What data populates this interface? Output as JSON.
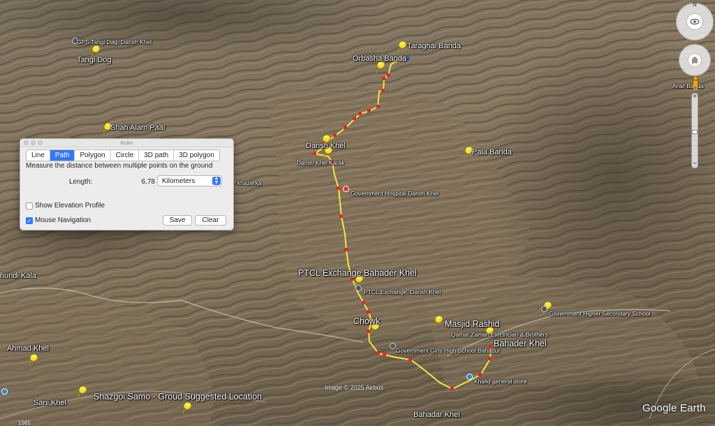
{
  "map": {
    "labels": {
      "tangi_dog": "Tangi Dog",
      "gps_tangi": "GPS Tangi Dag, Darish Khel",
      "taraghai_banda": "Taraghai Banda",
      "orbasha_banda": "Orbasha Banda",
      "anar_banda": "Anar Banda",
      "shah_alam_paal": "Shah Alam Paal",
      "darish_khel": "Darish Khel",
      "darish_khel_karak": "Darish Khel Karak",
      "pala_banda": "Pala Banda",
      "khazeka": "khazerka",
      "govt_hospital": "Government Hospital Darish Khel",
      "hundi_kala": "hundi Kala",
      "ptcl_exchange_big": "PTCL Exchange Bahader Khel",
      "ptcl_exchange_small": "PTCL Exchange, Darish Khel",
      "chowk": "Chowk",
      "masjid_rashid": "Masjid Rashid",
      "qamar_zaman": "Qamar Zaman Electrician & Brothers",
      "govt_girls_high": "Government Girls High School Bahadur",
      "bahader_khel": "Bahader Khel",
      "govt_higher_secondary": "Government Higher Secondary School",
      "ahmad_khel": "Ahmad Khel",
      "khalid_store": "Khalid general store",
      "sani_khel": "Sani Khel",
      "shazgoi_samo": "Shazgoi Samo - Groud Suggested Location",
      "bahadar_khel": "Bahadar Khel"
    },
    "credit": "Image © 2025 Airbus",
    "logo": "Google Earth",
    "status_left": "1985"
  },
  "ruler": {
    "title": "Ruler",
    "tabs": [
      "Line",
      "Path",
      "Polygon",
      "Circle",
      "3D path",
      "3D polygon"
    ],
    "active_tab": "Path",
    "description": "Measure the distance between multiple points on the ground",
    "length_label": "Length:",
    "length_value": "6.78",
    "unit": "Kilometers",
    "show_elevation_label": "Show Elevation Profile",
    "show_elevation_checked": false,
    "mouse_nav_label": "Mouse Navigation",
    "mouse_nav_checked": true,
    "save_label": "Save",
    "clear_label": "Clear"
  },
  "nav": {
    "north_label": "N",
    "zoom_in": "+",
    "zoom_out": "−"
  },
  "colors": {
    "path": "#f2e83a",
    "vertex": "#e0262a",
    "pin": "#f5e12a",
    "active_tab": "#3478f6"
  }
}
